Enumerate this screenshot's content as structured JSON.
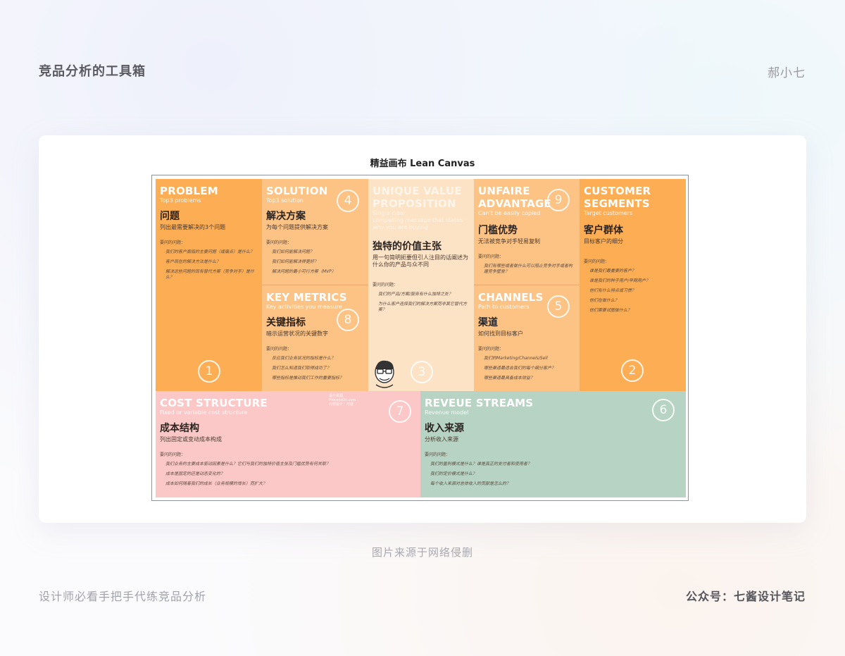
{
  "header": {
    "title": "竞品分析的工具箱",
    "author": "郝小七"
  },
  "canvas": {
    "title": "精益画布  Lean Canvas",
    "problem": {
      "en": "PROBLEM",
      "sub": "Top3 problems",
      "cn": "问题",
      "desc": "列出最需要解决的3个问题",
      "qlabel": "要问的问题：",
      "questions": [
        "我们的客户面临的主要问题（或痛点）是什么？",
        "客户现在的解决方法是什么？",
        "解决这些问题的现有替代方案（竞争对手）是什么？"
      ],
      "number": "1"
    },
    "solution": {
      "en": "SOLUTION",
      "sub": "Top3 solution",
      "cn": "解决方案",
      "desc": "为每个问题提供解决方案",
      "qlabel": "要问的问题：",
      "questions": [
        "我们如何能解决问题？",
        "我们如何能解决得更好？",
        "解决问题的最小可行方案（MVP）"
      ],
      "number": "4"
    },
    "metrics": {
      "en": "KEY METRICS",
      "sub": "Key activities you measure",
      "cn": "关键指标",
      "desc": "暗示运营状况的关键数字",
      "qlabel": "要问的问题：",
      "questions": [
        "反应我们业务状况的指标是什么？",
        "我们怎么知道我们取得成功了？",
        "哪些指标是推动我们工作的重要指标？"
      ],
      "number": "8"
    },
    "uvp": {
      "en1": "UNIQUE VALUE",
      "en2": "PROPOSITION",
      "sub1": "Single clear",
      "sub2": "compelling message that states",
      "sub3": "why you are buying",
      "cn": "独特的价值主张",
      "desc": "用一句简明扼要但引人注目的话阐述为什么你的产品与众不同",
      "qlabel": "要问的问题：",
      "questions": [
        "我们的产品/方案/服务有什么独特之处？",
        "为什么客户选择我们的解决方案而非其它替代方案？"
      ],
      "number": "3"
    },
    "advantage": {
      "en1": "UNFAIRE",
      "en2": "ADVANTAGE",
      "sub": "Can't be easily copied",
      "cn": "门槛优势",
      "desc": "无法被竞争对手轻易复制",
      "qlabel": "要问的问题：",
      "questions": [
        "我们有哪些或者做什么可以阻止竞争对手或者构建竞争壁垒？"
      ],
      "number": "9"
    },
    "channels": {
      "en": "CHANNELS",
      "sub": "Path to customers",
      "cn": "渠道",
      "desc": "如何找到目标客户",
      "qlabel": "要问的问题：",
      "questions": [
        "我们的Marketing/Channels/Sell",
        "哪些渠道最适合我们的每个细分客户？",
        "哪些渠道最具备成本效益？"
      ],
      "number": "5"
    },
    "segments": {
      "en1": "CUSTOMER",
      "en2": "SEGMENTS",
      "sub": "Target customers",
      "cn": "客户群体",
      "desc": "目标客户的细分",
      "qlabel": "要问的问题：",
      "questions": [
        "谁是我们最重要的客户？",
        "谁是我们的种子用户/早期用户？",
        "他们有什么特点或习惯？",
        "他们在做什么？",
        "他们需要试图做什么？"
      ],
      "number": "2"
    },
    "cost": {
      "en": "COST STRUCTURE",
      "sub": "Fixed or variable cost structure",
      "cn": "成本结构",
      "desc": "列出固定或变动成本构成",
      "qlabel": "要问的问题：",
      "questions": [
        "我们业务的主要成本驱动因素是什么？它们与我们的独特价值主张及门槛优势有何关联？",
        "成本是固定的还是动态变化的？",
        "成本如何随着我们的成长（业务规模的增长）而扩大？"
      ],
      "number": "7"
    },
    "revenue": {
      "en": "REVEUE STREAMS",
      "sub": "Revenue model",
      "cn": "收入来源",
      "desc": "分析收入来源",
      "qlabel": "要问的问题：",
      "questions": [
        "我们的盈利模式是什么？谁是真正的支付者和使用者？",
        "我们的定价模式是什么？",
        "每个收入来源对总体收入的贡献是怎么的？"
      ],
      "number": "6"
    },
    "watermark": [
      "设计来源",
      "ProcessOn.com",
      "内容设计：可道"
    ]
  },
  "caption": "图片来源于网络侵删",
  "footer": {
    "left": "设计师必看手把手代练竞品分析",
    "right": "公众号：七酱设计笔记"
  }
}
